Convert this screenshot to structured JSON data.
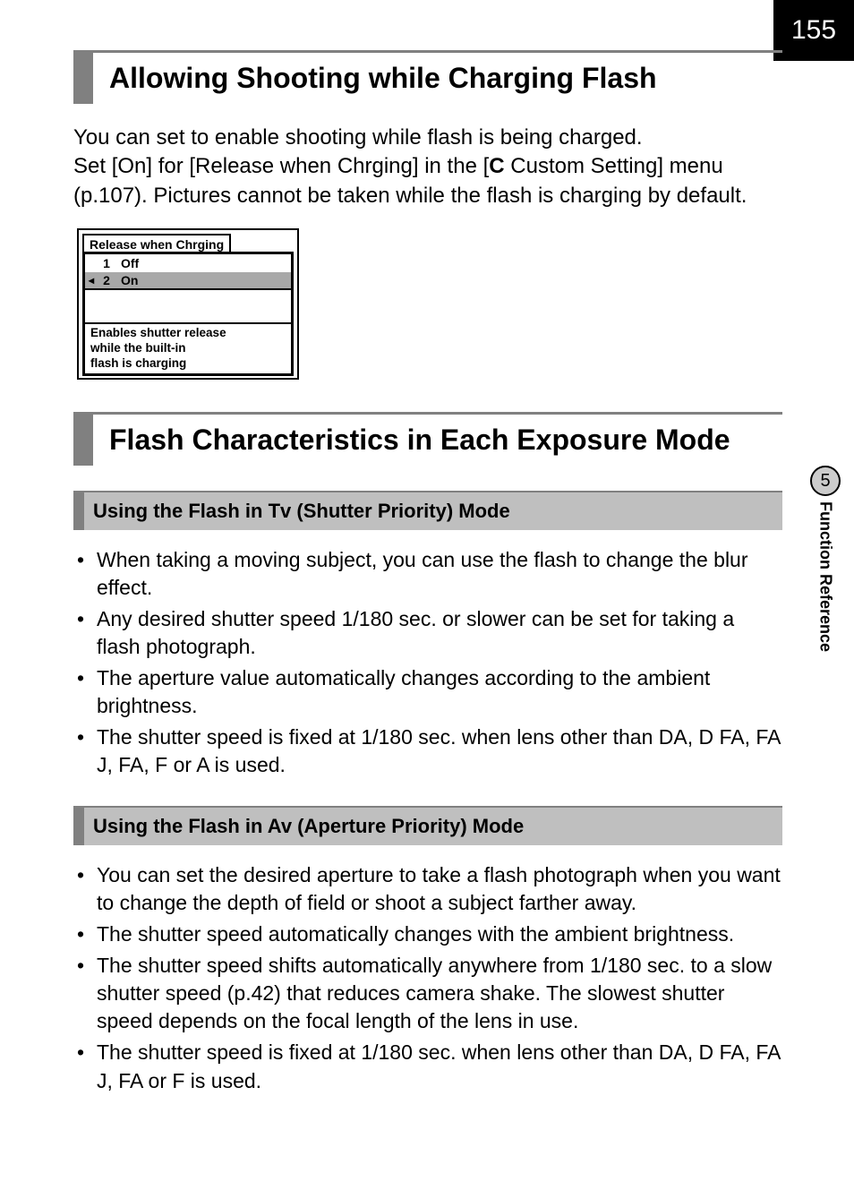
{
  "page_number": "155",
  "side_tab": {
    "chapter_num": "5",
    "chapter_title": "Function Reference"
  },
  "section1": {
    "title": "Allowing Shooting while Charging Flash",
    "paragraph_l1": "You can set to enable shooting while flash is being charged.",
    "paragraph_l2a": "Set [On] for [Release when Chrging] in the [",
    "glyph_c": "C",
    "paragraph_l2b": " Custom Setting] menu",
    "paragraph_l3": "(p.107). Pictures cannot be taken while the flash is charging by default."
  },
  "lcd": {
    "tab": "Release when Chrging",
    "row1_num": "1",
    "row1_label": "Off",
    "row2_num": "2",
    "row2_label": "On",
    "desc_l1": "Enables shutter release",
    "desc_l2": "while the built-in",
    "desc_l3": "flash is charging"
  },
  "section2": {
    "title": "Flash Characteristics in Each Exposure Mode"
  },
  "sub1": {
    "title_a": "Using the Flash in ",
    "title_glyph": "Tv",
    "title_b": " (Shutter Priority) Mode",
    "bullets": [
      "When taking a moving subject, you can use the flash to change the blur effect.",
      "Any desired shutter speed 1/180 sec. or slower can be set for taking a flash photograph.",
      "The aperture value automatically changes according to the ambient brightness.",
      "The shutter speed is fixed at 1/180 sec. when lens other than DA, D FA, FA J, FA, F or A is used."
    ]
  },
  "sub2": {
    "title": "Using the Flash in Av (Aperture Priority) Mode",
    "bullets": [
      "You can set the desired aperture to take a flash photograph when you want to change the depth of field or shoot a subject farther away.",
      "The shutter speed automatically changes with the ambient brightness.",
      "The shutter speed shifts automatically anywhere from 1/180 sec. to a slow shutter speed (p.42) that reduces camera shake. The slowest shutter speed depends on the focal length of the lens in use.",
      "The shutter speed is fixed at 1/180 sec. when lens other than DA, D FA, FA J, FA or F is used."
    ]
  }
}
